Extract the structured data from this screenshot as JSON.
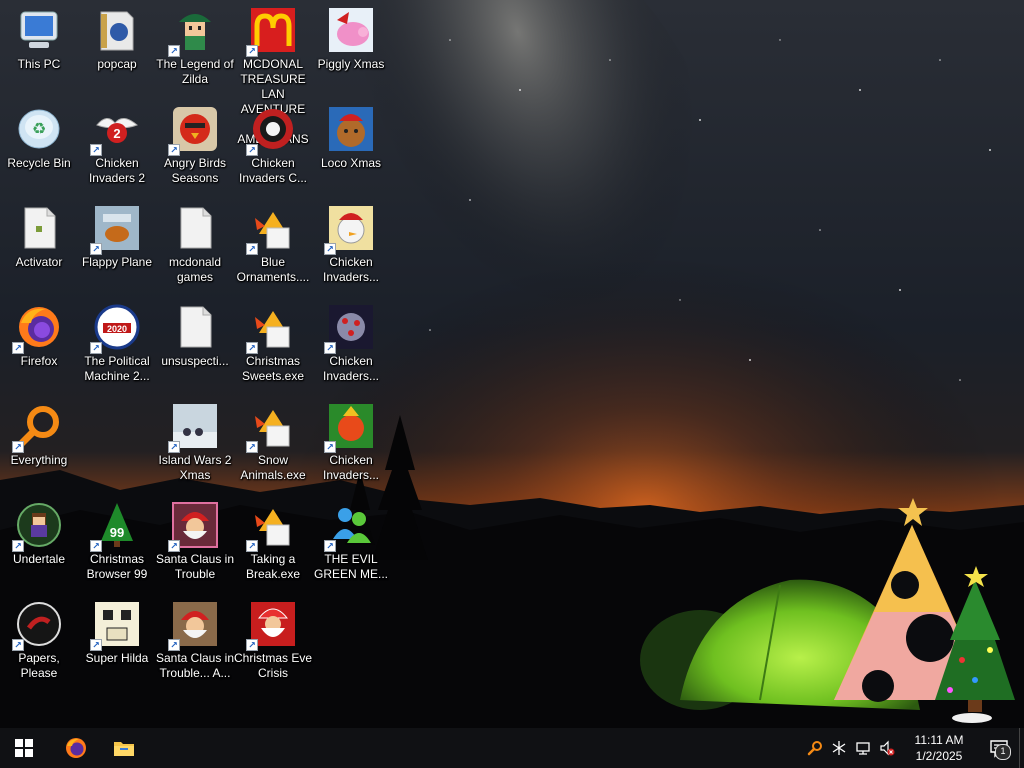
{
  "desktop": {
    "icons": [
      {
        "label": "This PC",
        "icon": "this-pc-icon",
        "shortcut": false
      },
      {
        "label": "Recycle Bin",
        "icon": "recycle-bin-icon",
        "shortcut": false
      },
      {
        "label": "Activator",
        "icon": "blank-file-icon",
        "shortcut": false
      },
      {
        "label": "Firefox",
        "icon": "firefox-icon",
        "shortcut": true
      },
      {
        "label": "Everything",
        "icon": "everything-search-icon",
        "shortcut": true
      },
      {
        "label": "Undertale",
        "icon": "undertale-icon",
        "shortcut": true
      },
      {
        "label": "Papers, Please",
        "icon": "papers-please-icon",
        "shortcut": true
      },
      {
        "label": "popcap",
        "icon": "folder-popcap-icon",
        "shortcut": false
      },
      {
        "label": "Chicken Invaders 2",
        "icon": "chicken-invaders-2-icon",
        "shortcut": true
      },
      {
        "label": "Flappy Plane",
        "icon": "flappy-plane-icon",
        "shortcut": true
      },
      {
        "label": "The Political Machine 2...",
        "icon": "political-machine-icon",
        "shortcut": true
      },
      {
        "label": "Christmas Browser 99",
        "icon": "christmas-browser-icon",
        "shortcut": true
      },
      {
        "label": "Super Hilda",
        "icon": "super-hilda-icon",
        "shortcut": true
      },
      {
        "label": "The Legend of Zilda",
        "icon": "legend-of-zilda-icon",
        "shortcut": true
      },
      {
        "label": "Angry Birds Seasons",
        "icon": "angry-birds-seasons-icon",
        "shortcut": true
      },
      {
        "label": "mcdonald games",
        "icon": "blank-file-icon",
        "shortcut": false
      },
      {
        "label": "unsuspecti...",
        "icon": "blank-file-icon",
        "shortcut": false
      },
      {
        "label": "Island Wars 2 Xmas",
        "icon": "island-wars-icon",
        "shortcut": true
      },
      {
        "label": "Santa Claus in Trouble",
        "icon": "santa-claus-icon",
        "shortcut": true
      },
      {
        "label": "Santa Claus in Trouble... A...",
        "icon": "santa-claus-2-icon",
        "shortcut": true
      },
      {
        "label": "MCDONAL TREASURE LAN AVENTURE FOR AMERICANS",
        "icon": "mcdonalds-icon",
        "shortcut": true
      },
      {
        "label": "Chicken Invaders C...",
        "icon": "chicken-invaders-c-icon",
        "shortcut": true
      },
      {
        "label": "Blue Ornaments....",
        "icon": "game-exe-icon",
        "shortcut": true
      },
      {
        "label": "Christmas Sweets.exe",
        "icon": "game-exe-icon",
        "shortcut": true
      },
      {
        "label": "Snow Animals.exe",
        "icon": "game-exe-icon",
        "shortcut": true
      },
      {
        "label": "Taking a Break.exe",
        "icon": "game-exe-icon",
        "shortcut": true
      },
      {
        "label": "Christmas Eve Crisis",
        "icon": "christmas-eve-crisis-icon",
        "shortcut": true
      },
      {
        "label": "Piggly Xmas",
        "icon": "piggly-xmas-icon",
        "shortcut": false
      },
      {
        "label": "Loco Xmas",
        "icon": "loco-xmas-icon",
        "shortcut": false
      },
      {
        "label": "Chicken Invaders...",
        "icon": "chicken-invaders-xmas-icon",
        "shortcut": true
      },
      {
        "label": "Chicken Invaders...",
        "icon": "chicken-invaders-space-icon",
        "shortcut": true
      },
      {
        "label": "Chicken Invaders...",
        "icon": "chicken-invaders-green-icon",
        "shortcut": true
      },
      {
        "label": "THE EVIL GREEN ME...",
        "icon": "evil-green-messenger-icon",
        "shortcut": true
      }
    ]
  },
  "taskbar": {
    "start": "windows-start-icon",
    "pinned": [
      "firefox-icon",
      "file-explorer-icon"
    ],
    "tray": [
      "everything-tray-icon",
      "bluetooth-icon",
      "network-icon",
      "volume-muted-icon"
    ],
    "time": "11:11 AM",
    "date": "1/2/2025",
    "notifications_count": "1"
  },
  "colors": {
    "taskbar": "#101114",
    "sky": "#1a2232",
    "horizon": "#c8551c",
    "tent": "#7ecf2a"
  }
}
